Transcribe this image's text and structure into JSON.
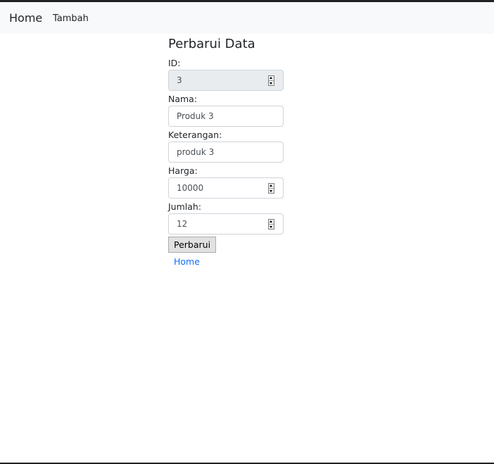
{
  "navbar": {
    "brand": "Home",
    "links": [
      {
        "label": "Tambah"
      }
    ]
  },
  "form": {
    "title": "Perbarui Data",
    "fields": [
      {
        "label": "ID:",
        "value": "3",
        "type": "number",
        "readonly": true
      },
      {
        "label": "Nama:",
        "value": "Produk 3",
        "type": "text",
        "readonly": false
      },
      {
        "label": "Keterangan:",
        "value": "produk 3",
        "type": "text",
        "readonly": false
      },
      {
        "label": "Harga:",
        "value": "10000",
        "type": "number",
        "readonly": false
      },
      {
        "label": "Jumlah:",
        "value": "12",
        "type": "number",
        "readonly": false
      }
    ],
    "submit_label": "Perbarui",
    "home_link": "Home"
  },
  "colors": {
    "navbar_bg": "#f8f9fa",
    "link": "#0d6efd",
    "readonly_bg": "#e9ecef",
    "input_border": "#ced4da"
  },
  "icons": {
    "number_spinner": "spinner-updown-icon"
  }
}
